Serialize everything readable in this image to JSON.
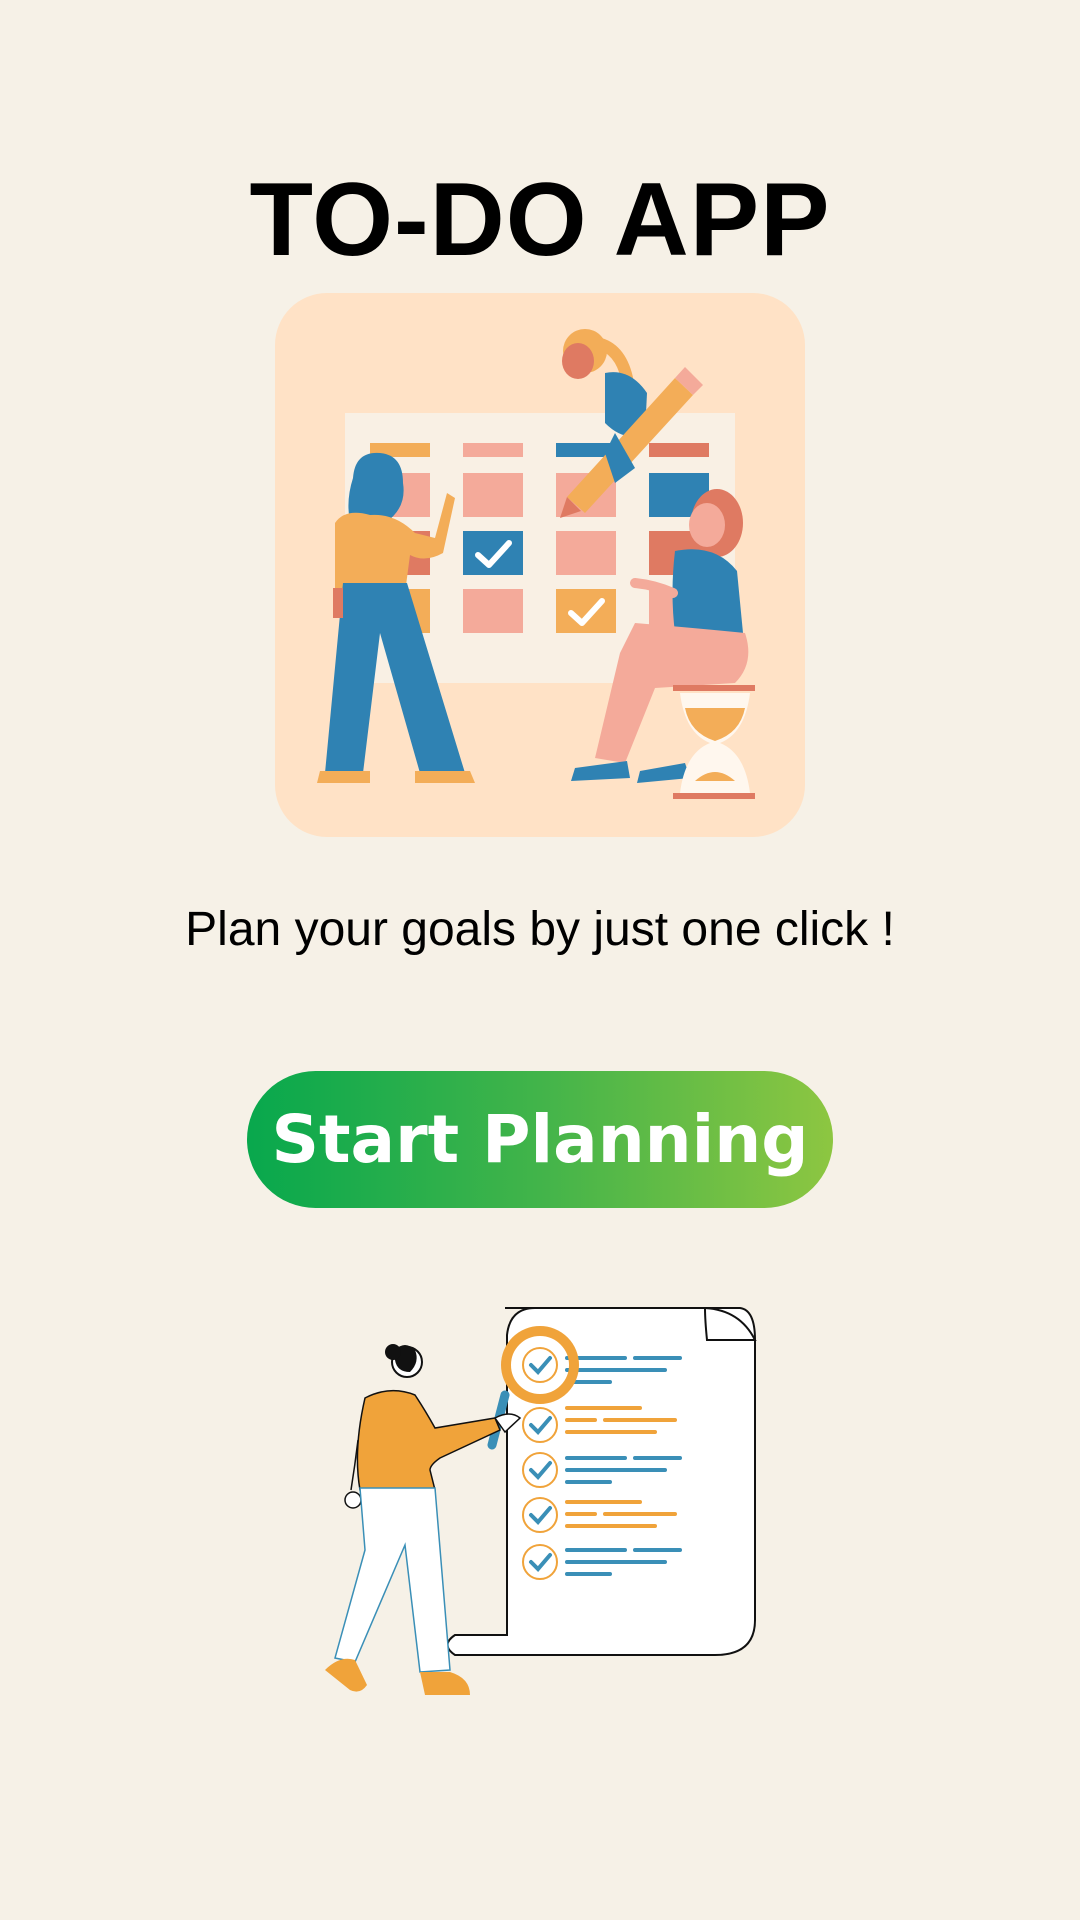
{
  "app": {
    "title": "TO-DO APP",
    "tagline": "Plan your goals by just one click !"
  },
  "cta": {
    "label": "Start Planning"
  },
  "illustrations": {
    "hero": "team-planning-calendar-illustration",
    "bottom": "checklist-scroll-illustration"
  },
  "colors": {
    "background": "#f6f1e7",
    "hero_card": "#ffe2c6",
    "button_gradient_start": "#08a84d",
    "button_gradient_end": "#8dc641",
    "accent_blue": "#2f82b3",
    "accent_orange": "#f3ad58",
    "accent_pink": "#f4aa9a",
    "accent_red": "#df7a62"
  }
}
